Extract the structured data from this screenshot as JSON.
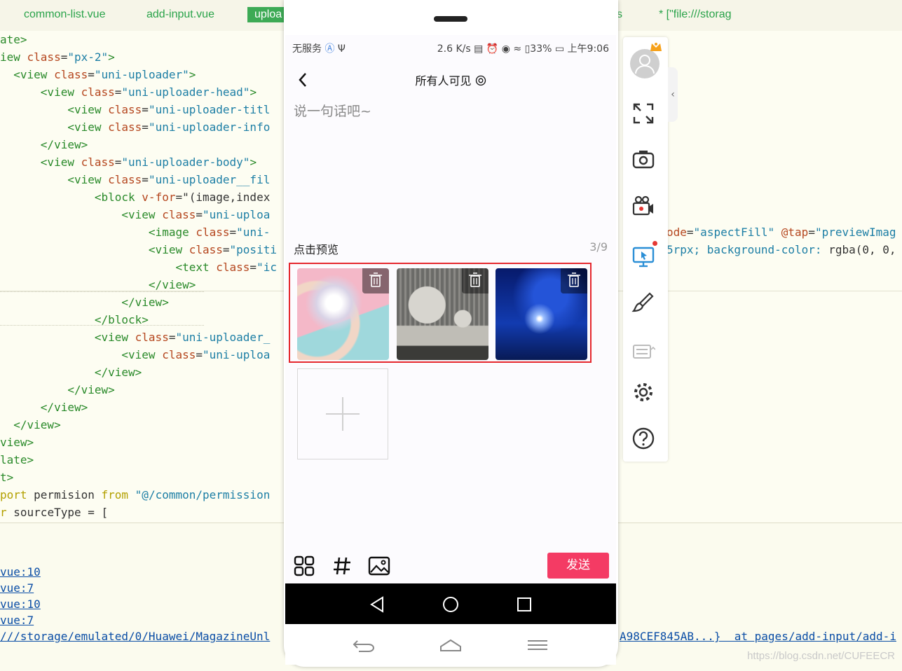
{
  "editor": {
    "tabs": [
      "common-list.vue",
      "add-input.vue",
      "uploa",
      "s",
      "* [\"file:///storag"
    ],
    "code_lines": [
      [
        [
          "tg",
          "ate>"
        ]
      ],
      [
        [
          "tg",
          "iew "
        ],
        [
          "at",
          "class"
        ],
        [
          "pl",
          "="
        ],
        [
          "st",
          "\"px-2\""
        ],
        [
          "tg",
          ">"
        ]
      ],
      [
        [
          "pl",
          "  "
        ],
        [
          "tg",
          "<view "
        ],
        [
          "at",
          "class"
        ],
        [
          "pl",
          "="
        ],
        [
          "st",
          "\"uni-uploader\""
        ],
        [
          "tg",
          ">"
        ]
      ],
      [
        [
          "pl",
          "      "
        ],
        [
          "tg",
          "<view "
        ],
        [
          "at",
          "class"
        ],
        [
          "pl",
          "="
        ],
        [
          "st",
          "\"uni-uploader-head\""
        ],
        [
          "tg",
          ">"
        ]
      ],
      [
        [
          "pl",
          "          "
        ],
        [
          "tg",
          "<view "
        ],
        [
          "at",
          "class"
        ],
        [
          "pl",
          "="
        ],
        [
          "st",
          "\"uni-uploader-titl"
        ]
      ],
      [
        [
          "pl",
          "          "
        ],
        [
          "tg",
          "<view "
        ],
        [
          "at",
          "class"
        ],
        [
          "pl",
          "="
        ],
        [
          "st",
          "\"uni-uploader-info"
        ]
      ],
      [
        [
          "pl",
          "      "
        ],
        [
          "tg",
          "</view>"
        ]
      ],
      [
        [
          "pl",
          "      "
        ],
        [
          "tg",
          "<view "
        ],
        [
          "at",
          "class"
        ],
        [
          "pl",
          "="
        ],
        [
          "st",
          "\"uni-uploader-body\""
        ],
        [
          "tg",
          ">"
        ]
      ],
      [
        [
          "pl",
          "          "
        ],
        [
          "tg",
          "<view "
        ],
        [
          "at",
          "class"
        ],
        [
          "pl",
          "="
        ],
        [
          "st",
          "\"uni-uploader__fil"
        ]
      ],
      [
        [
          "pl",
          "              "
        ],
        [
          "tg",
          "<block "
        ],
        [
          "at",
          "v-for"
        ],
        [
          "pl",
          "=\"(image,index"
        ]
      ],
      [
        [
          "pl",
          "                  "
        ],
        [
          "tg",
          "<view "
        ],
        [
          "at",
          "class"
        ],
        [
          "pl",
          "="
        ],
        [
          "st",
          "\"uni-uploa"
        ]
      ],
      [
        [
          "pl",
          "                      "
        ],
        [
          "tg",
          "<image "
        ],
        [
          "at",
          "class"
        ],
        [
          "pl",
          "="
        ],
        [
          "st",
          "\"uni-"
        ]
      ],
      [
        [
          "pl",
          "                      "
        ],
        [
          "tg",
          "<view "
        ],
        [
          "at",
          "class"
        ],
        [
          "pl",
          "="
        ],
        [
          "st",
          "\"positi"
        ]
      ],
      [
        [
          "pl",
          "                          "
        ],
        [
          "tg",
          "<text "
        ],
        [
          "at",
          "class"
        ],
        [
          "pl",
          "="
        ],
        [
          "st",
          "\"ic"
        ]
      ],
      [
        [
          "pl",
          "                      "
        ],
        [
          "tg",
          "</view>"
        ]
      ],
      [
        [
          "pl",
          "                  "
        ],
        [
          "tg",
          "</view>"
        ]
      ],
      [
        [
          "pl",
          "              "
        ],
        [
          "tg",
          "</block>"
        ]
      ],
      [
        [
          "pl",
          "              "
        ],
        [
          "tg",
          "<view "
        ],
        [
          "at",
          "class"
        ],
        [
          "pl",
          "="
        ],
        [
          "st",
          "\"uni-uploader_"
        ]
      ],
      [
        [
          "pl",
          "                  "
        ],
        [
          "tg",
          "<view "
        ],
        [
          "at",
          "class"
        ],
        [
          "pl",
          "="
        ],
        [
          "st",
          "\"uni-uploa"
        ]
      ],
      [
        [
          "pl",
          "              "
        ],
        [
          "tg",
          "</view>"
        ]
      ],
      [
        [
          "pl",
          "          "
        ],
        [
          "tg",
          "</view>"
        ]
      ],
      [
        [
          "pl",
          "      "
        ],
        [
          "tg",
          "</view>"
        ]
      ],
      [
        [
          "pl",
          "  "
        ],
        [
          "tg",
          "</view>"
        ]
      ],
      [
        [
          "tg",
          "view>"
        ]
      ],
      [
        [
          "tg",
          "late>"
        ]
      ],
      [
        [
          "tg",
          "t>"
        ]
      ],
      [
        [
          "kw",
          "port"
        ],
        [
          "pl",
          " permision "
        ],
        [
          "kw",
          "from"
        ],
        [
          "pl",
          " "
        ],
        [
          "st",
          "\"@/common/permission"
        ]
      ],
      [
        [
          "kw",
          "r"
        ],
        [
          "pl",
          " sourceType = ["
        ]
      ]
    ],
    "right_code": [
      [
        [
          "at",
          "ode"
        ],
        [
          "pl",
          "="
        ],
        [
          "st",
          "\"aspectFill\""
        ],
        [
          "pl",
          " "
        ],
        [
          "at",
          "@tap"
        ],
        [
          "pl",
          "="
        ],
        [
          "st",
          "\"previewImag"
        ]
      ],
      [
        [
          "st",
          "5rpx; background-color: "
        ],
        [
          "pl",
          "rgba(0, 0,"
        ]
      ]
    ],
    "console_lines": [
      "vue:10",
      "vue:7",
      "vue:10",
      "vue:7"
    ],
    "console_path": "///storage/emulated/0/Huawei/MagazineUnl",
    "console_right": "A98CEF845AB...}  at pages/add-input/add-i",
    "watermark": "https://blog.csdn.net/CUFEECR"
  },
  "phone": {
    "status_left": "无服务",
    "status_speed": "2.6 K/s",
    "status_battery": "33%",
    "status_time": "上午9:06",
    "nav_title": "所有人可见",
    "textarea_placeholder": "说一句话吧~",
    "preview_label": "点击预览",
    "count": "3/9",
    "send_label": "发送",
    "images": [
      {
        "name": "pink-sphere",
        "palette": [
          "#f4b8c8",
          "#9fd8dc",
          "#e6dde8"
        ]
      },
      {
        "name": "gray-sofa-room",
        "palette": [
          "#6b6b68",
          "#bfbdb6",
          "#d7d5cf"
        ]
      },
      {
        "name": "blue-starry-sky",
        "palette": [
          "#071a6b",
          "#2454d8",
          "#9dc0ff"
        ]
      }
    ]
  },
  "colors": {
    "accent": "#f43b64",
    "highlight_border": "#e5282e",
    "editor_tag": "#2a8a2a"
  }
}
